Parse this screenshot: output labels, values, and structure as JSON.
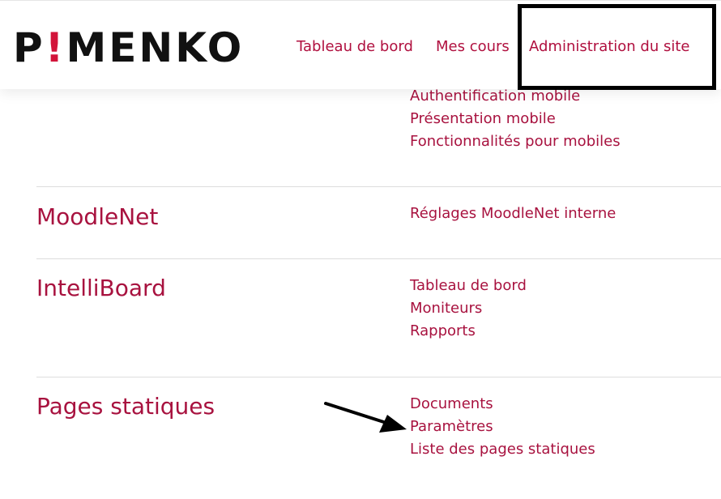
{
  "header": {
    "logo": {
      "prefix": "P",
      "mark": "!",
      "suffix": "MENKO"
    },
    "nav": [
      {
        "label": "Tableau de bord"
      },
      {
        "label": "Mes cours"
      },
      {
        "label": "Administration du site"
      }
    ]
  },
  "mobile_links": [
    {
      "label": "Authentification mobile"
    },
    {
      "label": "Présentation mobile"
    },
    {
      "label": "Fonctionnalités pour mobiles"
    }
  ],
  "sections": [
    {
      "title": "MoodleNet",
      "links": [
        {
          "label": "Réglages MoodleNet interne"
        }
      ]
    },
    {
      "title": "IntelliBoard",
      "links": [
        {
          "label": "Tableau de bord"
        },
        {
          "label": "Moniteurs"
        },
        {
          "label": "Rapports"
        }
      ]
    },
    {
      "title": "Pages statiques",
      "links": [
        {
          "label": "Documents"
        },
        {
          "label": "Paramètres"
        },
        {
          "label": "Liste des pages statiques"
        }
      ]
    }
  ],
  "colors": {
    "accent": "#a8123f",
    "logo_mark": "#d2143a",
    "annotation": "#000000"
  },
  "annotations": {
    "highlighted_item": "Administration du site",
    "arrow_target": "Paramètres"
  }
}
